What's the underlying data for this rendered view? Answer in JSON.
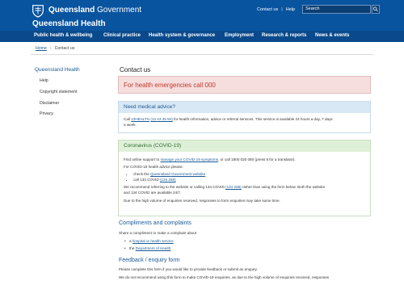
{
  "header": {
    "brand_bold": "Queensland",
    "brand_light": "Government",
    "site_title": "Queensland Health",
    "top_links": [
      "Contact us",
      "Help"
    ],
    "search_placeholder": "Search"
  },
  "nav": [
    "Public health & wellbeing",
    "Clinical practice",
    "Health system & governance",
    "Employment",
    "Research & reports",
    "News & events"
  ],
  "breadcrumb": [
    "Home",
    "Contact us"
  ],
  "sidebar": {
    "title": "Queensland Health",
    "items": [
      "Help",
      "Copyright statement",
      "Disclaimer",
      "Privacy"
    ]
  },
  "main": {
    "title": "Contact us",
    "alert": "For health emergencies call 000",
    "advice": {
      "heading": "Need medical advice?",
      "line1_pre": "Call ",
      "line1_link1": "13HEALTH",
      "line1_link2": "(13 43 25 84)",
      "line1_post": " for health information, advice or referral services. This service is available 24 hours a day, 7 days",
      "line2": "a week."
    },
    "covid": {
      "heading": "Coronavirus (COVID-19)",
      "p1_pre": "Find online support to ",
      "p1_link": "manage your COVID-19 symptoms",
      "p1_post": ", or call 1800 020 080 (press 8 for a translator).",
      "p2": "For COVID-19 health advice please:",
      "b1_pre": "check the ",
      "b1_link": "Queensland Government website",
      "b2_pre": "call 134 COVID ",
      "b2_link": "(134 268)",
      "p3_pre": "We recommend referring to the website or calling 134 COVID ",
      "p3_link": "(134 268)",
      "p3_post": " rather than using the form below. Both the website",
      "p3_line2": "and 134 COVID are available 24/7.",
      "p4": "Due to the high volume of enquiries received, responses to form enquiries may take some time."
    },
    "compliments": {
      "heading": "Compliments and complaints",
      "intro": "Share a compliment or make a complaint about",
      "b1_pre": "a ",
      "b1_link": "hospital or health service",
      "b2_pre": "the ",
      "b2_link": "Department of Health",
      "b2_post": "."
    },
    "feedback": {
      "heading": "Feedback / enquiry form",
      "p1": "Please complete this form if you would like to provide feedback or submit an enquiry.",
      "p2": "We do not recommend using this form to make COVID-19 enquiries, as due to the high volume of enquiries received, responses"
    }
  }
}
